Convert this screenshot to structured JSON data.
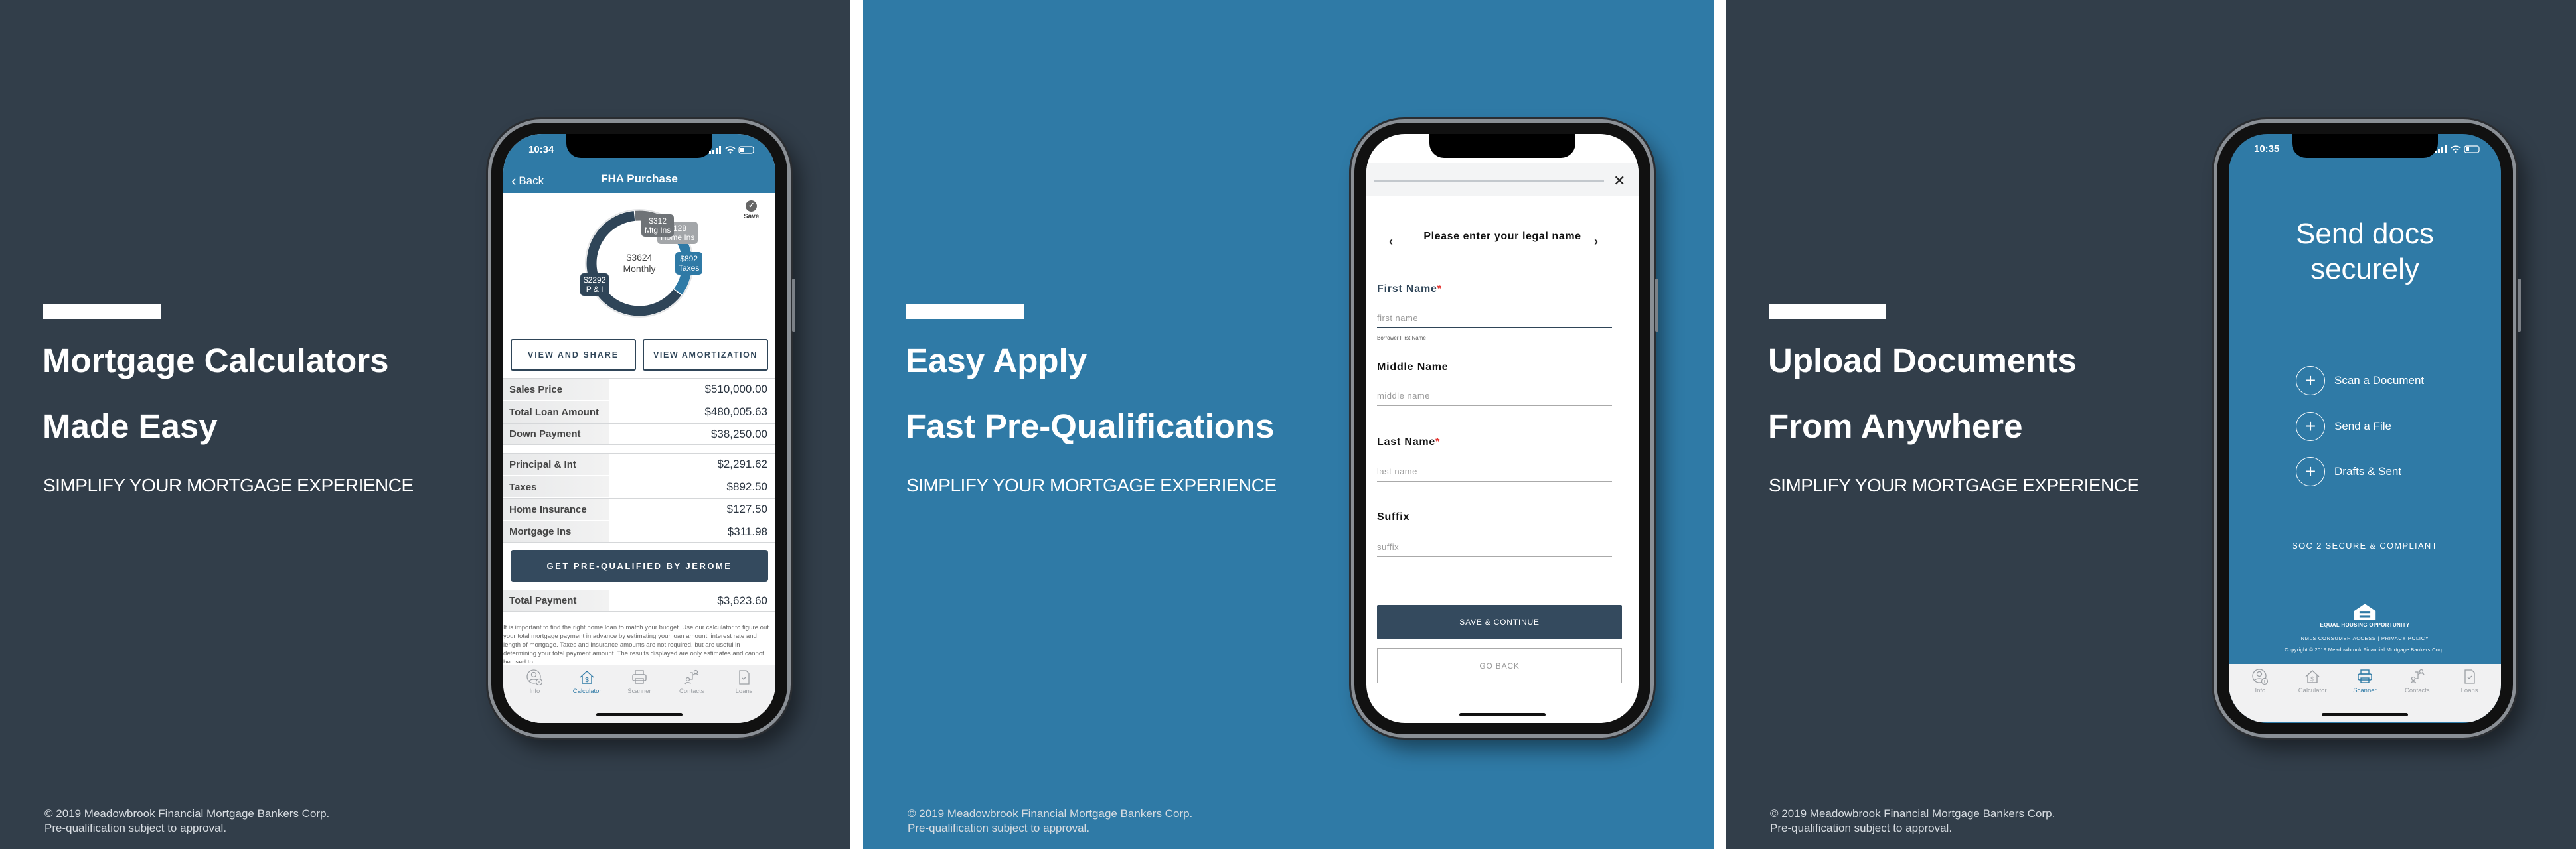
{
  "colors": {
    "dark_panel": "#323e4a",
    "blue_panel": "#2f7aa6",
    "navy_button": "#344a5e",
    "required": "#e53935"
  },
  "panels": [
    {
      "headline": [
        "Mortgage Calculators",
        "Made Easy"
      ],
      "subtitle": "SIMPLIFY YOUR MORTGAGE EXPERIENCE",
      "footer": [
        "© 2019 Meadowbrook Financial Mortgage Bankers Corp.",
        "Pre-qualification subject to approval."
      ]
    },
    {
      "headline": [
        "Easy Apply",
        "Fast Pre-Qualifications"
      ],
      "subtitle": "SIMPLIFY YOUR MORTGAGE EXPERIENCE",
      "footer": [
        "© 2019 Meadowbrook Financial Mortgage Bankers Corp.",
        "Pre-qualification subject to approval."
      ]
    },
    {
      "headline": [
        "Upload Documents",
        "From Anywhere"
      ],
      "subtitle": "SIMPLIFY YOUR MORTGAGE EXPERIENCE",
      "footer": [
        "© 2019 Meadowbrook Financial Mortgage Bankers Corp.",
        "Pre-qualification subject to approval."
      ]
    }
  ],
  "tab_bar": {
    "items": [
      {
        "label": "Info",
        "icon": "user-info-icon"
      },
      {
        "label": "Calculator",
        "icon": "house-dollar-icon"
      },
      {
        "label": "Scanner",
        "icon": "printer-icon"
      },
      {
        "label": "Contacts",
        "icon": "contacts-icon"
      },
      {
        "label": "Loans",
        "icon": "document-check-icon"
      }
    ]
  },
  "calculator_screen": {
    "time": "10:34",
    "back_label": "Back",
    "title": "FHA Purchase",
    "save_label": "Save",
    "donut": {
      "center_value": "$3624",
      "center_label": "Monthly",
      "segments": [
        {
          "value": 312,
          "amount": "$312",
          "label": "Mtg Ins",
          "color": "#6f7377"
        },
        {
          "value": 128,
          "amount": "$128",
          "label": "Home Ins",
          "color": "#a3a6a9"
        },
        {
          "value": 892,
          "amount": "$892",
          "label": "Taxes",
          "color": "#2f7aa6"
        },
        {
          "value": 2292,
          "amount": "$2292",
          "label": "P & I",
          "color": "#2f4558"
        }
      ]
    },
    "view_share_label": "VIEW AND SHARE",
    "view_amortization_label": "VIEW AMORTIZATION",
    "rows_loan": [
      {
        "label": "Sales Price",
        "value": "$510,000.00"
      },
      {
        "label": "Total Loan Amount",
        "value": "$480,005.63"
      },
      {
        "label": "Down Payment",
        "value": "$38,250.00"
      }
    ],
    "rows_payment": [
      {
        "label": "Principal & Int",
        "value": "$2,291.62"
      },
      {
        "label": "Taxes",
        "value": "$892.50"
      },
      {
        "label": "Home Insurance",
        "value": "$127.50"
      },
      {
        "label": "Mortgage Ins",
        "value": "$311.98"
      }
    ],
    "prequal_label": "GET PRE-QUALIFIED BY JEROME",
    "total": {
      "label": "Total Payment",
      "value": "$3,623.60"
    },
    "disclaimer": "It is important to find the right home loan to match your budget. Use our calculator to figure out your total mortgage payment in advance by estimating your loan amount, interest rate and length of mortgage. Taxes and insurance amounts are not required, but are useful in determining your total payment amount. The results displayed are only estimates and cannot be used to",
    "active_tab": "Calculator"
  },
  "apply_screen": {
    "progress": 0,
    "question": "Please enter your legal name",
    "fields": [
      {
        "label": "First Name",
        "required": "*",
        "placeholder": "first name",
        "helper": "Borrower First Name"
      },
      {
        "label": "Middle Name",
        "required": "",
        "placeholder": "middle name"
      },
      {
        "label": "Last Name",
        "required": "*",
        "placeholder": "last name"
      },
      {
        "label": "Suffix",
        "required": "",
        "placeholder": "suffix"
      }
    ],
    "save_label": "SAVE & CONTINUE",
    "back_label": "GO BACK"
  },
  "docs_screen": {
    "time": "10:35",
    "title_lines": [
      "Send docs",
      "securely"
    ],
    "actions": [
      "Scan a Document",
      "Send a File",
      "Drafts & Sent"
    ],
    "compliance": "SOC 2 SECURE & COMPLIANT",
    "logo_text": "EQUAL HOUSING OPPORTUNITY",
    "links": [
      "NMLS CONSUMER ACCESS",
      "|",
      "PRIVACY POLICY"
    ],
    "copyright": "Copyright © 2019 Meadowbrook Financial Mortgage Bankers Corp.",
    "active_tab": "Scanner"
  }
}
